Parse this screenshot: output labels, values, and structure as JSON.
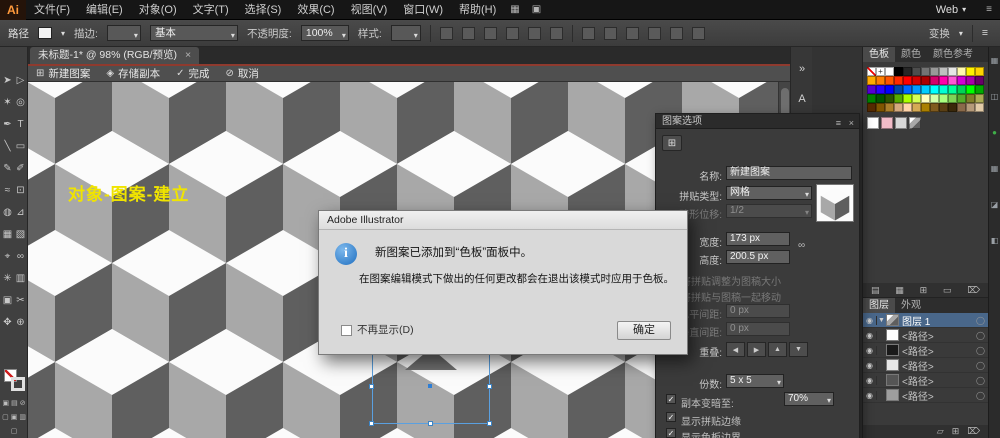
{
  "ui": {
    "caret": "▾",
    "close": "×",
    "menu": "≡",
    "check": "✓",
    "collapse": "»",
    "grid_icon": "⊞",
    "diamond_icon": "◈",
    "cancel_icon": "⊘",
    "info_glyph": "i",
    "link_icon": "∞",
    "tile_tool_icon": "⊞",
    "reg_glyph": "+"
  },
  "menu_bar": {
    "logo": "Ai",
    "items": [
      "文件(F)",
      "编辑(E)",
      "对象(O)",
      "文字(T)",
      "选择(S)",
      "效果(C)",
      "视图(V)",
      "窗口(W)",
      "帮助(H)"
    ],
    "window_icons": [
      "▦",
      "▣"
    ],
    "workspace": "Web"
  },
  "control_bar": {
    "object_label": "路径",
    "stroke_label": "描边:",
    "brush_value": "基本",
    "opacity_label": "不透明度:",
    "opacity_value": "100%",
    "style_label": "样式:",
    "transform_label": "变换"
  },
  "document_tab": {
    "title": "未标题-1* @ 98% (RGB/预览)"
  },
  "pattern_bar": {
    "name_label": "新建图案",
    "save_copy": "存储副本",
    "done": "完成",
    "cancel": "取消"
  },
  "canvas": {
    "annotation": "对象-图案-建立",
    "cube_colors": {
      "top": "#fbfbfb",
      "left": "#a8a8a8",
      "right": "#5f5f5f"
    }
  },
  "dialog": {
    "title": "Adobe Illustrator",
    "message_line1": "新图案已添加到“色板”面板中。",
    "message_line2": "在图案编辑模式下做出的任何更改都会在退出该模式时应用于色板。",
    "checkbox_label": "不再显示(D)",
    "ok_label": "确定"
  },
  "pattern_options": {
    "title": "图案选项",
    "name_label": "名称:",
    "name_value": "新建图案",
    "tile_type_label": "拼贴类型:",
    "tile_type_value": "网格",
    "brick_offset_label": "砖形位移:",
    "brick_offset_value": "1/2",
    "width_label": "宽度:",
    "width_value": "173 px",
    "height_label": "高度:",
    "height_value": "200.5 px",
    "size_tile_to_art": "将拼贴调整为图稿大小",
    "move_tile_with_art": "将拼贴与图稿一起移动",
    "h_spacing_label": "水平间距:",
    "h_spacing_value": "0 px",
    "v_spacing_label": "垂直间距:",
    "v_spacing_value": "0 px",
    "overlap_label": "重叠:",
    "copies_label": "份数:",
    "copies_value": "5 x 5",
    "dim_copies_label": "副本变暗至:",
    "dim_copies_value": "70%",
    "show_tile_edge": "显示拼贴边缘",
    "show_swatch_bounds": "显示色板边界"
  },
  "overlap_icons": [
    "◀",
    "▶",
    "▲",
    "▼"
  ],
  "tools": [
    {
      "name": "selection-tool",
      "glyph": "➤"
    },
    {
      "name": "direct-selection-tool",
      "glyph": "▷"
    },
    {
      "name": "magic-wand-tool",
      "glyph": "✶"
    },
    {
      "name": "lasso-tool",
      "glyph": "◎"
    },
    {
      "name": "pen-tool",
      "glyph": "✒"
    },
    {
      "name": "type-tool",
      "glyph": "T"
    },
    {
      "name": "line-segment-tool",
      "glyph": "╲"
    },
    {
      "name": "rectangle-tool",
      "glyph": "▭"
    },
    {
      "name": "paintbrush-tool",
      "glyph": "✎"
    },
    {
      "name": "pencil-tool",
      "glyph": "✐"
    },
    {
      "name": "width-tool",
      "glyph": "≈"
    },
    {
      "name": "free-transform-tool",
      "glyph": "⊡"
    },
    {
      "name": "shape-builder-tool",
      "glyph": "◍"
    },
    {
      "name": "perspective-grid-tool",
      "glyph": "⊿"
    },
    {
      "name": "mesh-tool",
      "glyph": "▦"
    },
    {
      "name": "gradient-tool",
      "glyph": "▧"
    },
    {
      "name": "eyedropper-tool",
      "glyph": "⌖"
    },
    {
      "name": "blend-tool",
      "glyph": "∞"
    },
    {
      "name": "symbol-sprayer-tool",
      "glyph": "✳"
    },
    {
      "name": "column-graph-tool",
      "glyph": "▥"
    },
    {
      "name": "artboard-tool",
      "glyph": "▣"
    },
    {
      "name": "slice-tool",
      "glyph": "✂"
    },
    {
      "name": "hand-tool",
      "glyph": "✥"
    },
    {
      "name": "zoom-tool",
      "glyph": "⊕"
    }
  ],
  "swatches_panel": {
    "tabs": [
      {
        "label": "色板",
        "bg": "#4a4a4a",
        "color": "#e8e8e8"
      },
      {
        "label": "颜色",
        "bg": "transparent",
        "color": "#b0b0b0"
      },
      {
        "label": "颜色参考",
        "bg": "transparent",
        "color": "#b0b0b0"
      }
    ],
    "colors": [
      "#ffffff",
      "#000000",
      "#262626",
      "#4d4d4d",
      "#737373",
      "#999999",
      "#bfbfbf",
      "#e6e6e6",
      "#fff9ae",
      "#fff200",
      "#ffd400",
      "#ffaa00",
      "#ff7f00",
      "#ff5500",
      "#ff2a00",
      "#ff0000",
      "#d40000",
      "#aa0000",
      "#d4006a",
      "#ff00aa",
      "#ff55d4",
      "#d400d4",
      "#aa00aa",
      "#6a006a",
      "#5500d4",
      "#2a00ff",
      "#0000ff",
      "#0044aa",
      "#0066ff",
      "#0099ff",
      "#00ccff",
      "#00ffff",
      "#00ffd4",
      "#00ff99",
      "#00d455",
      "#00ff00",
      "#00aa00",
      "#007f00",
      "#005500",
      "#2a5500",
      "#55aa00",
      "#aaff00",
      "#d4ff55",
      "#ffffbf",
      "#d4ffaa",
      "#aaff7f",
      "#7fd455",
      "#55aa2a",
      "#7f7f2a",
      "#aaaa55",
      "#552a00",
      "#7f5500",
      "#aa7f2a",
      "#d4aa7f",
      "#ffd4aa",
      "#d4aa55",
      "#aa7f00",
      "#7f5a1e",
      "#5a3f14",
      "#3a280a",
      "#8a6a4a",
      "#b59a7a",
      "#e2cba8"
    ],
    "extra": [
      "#ffffff",
      "#f2bcc8",
      "#d8d8d8",
      "linear-gradient(135deg,#ffffff 30%,#a8a8a8 30%,#a8a8a8 60%,#5f5f5f 60%)"
    ],
    "footer_icons": [
      "▤",
      "▦",
      "⊞",
      "▭",
      "⌦"
    ]
  },
  "layers_panel": {
    "tabs": [
      {
        "label": "图层",
        "bg": "#4a4a4a",
        "color": "#e8e8e8"
      },
      {
        "label": "外观",
        "bg": "transparent",
        "color": "#b0b0b0"
      }
    ],
    "rows": [
      {
        "label": "图层 1",
        "eye": "◉",
        "twist": "▼",
        "thumb": "linear-gradient(135deg,#ffffff 30%,#a8a8a8 30%,#a8a8a8 60%,#5f5f5f 60%)",
        "bg": "#49678a",
        "color": "#ffffff",
        "target": "◯"
      },
      {
        "label": "<路径>",
        "eye": "◉",
        "twist": "",
        "thumb": "#ffffff",
        "bg": "transparent",
        "color": "#c6c6c6",
        "target": "◯"
      },
      {
        "label": "<路径>",
        "eye": "◉",
        "twist": "",
        "thumb": "#1a1a1a",
        "bg": "transparent",
        "color": "#c6c6c6",
        "target": "◯"
      },
      {
        "label": "<路径>",
        "eye": "◉",
        "twist": "",
        "thumb": "#e6e6e6",
        "bg": "transparent",
        "color": "#c6c6c6",
        "target": "◯"
      },
      {
        "label": "<路径>",
        "eye": "◉",
        "twist": "",
        "thumb": "#555555",
        "bg": "transparent",
        "color": "#c6c6c6",
        "target": "◯"
      },
      {
        "label": "<路径>",
        "eye": "◉",
        "twist": "",
        "thumb": "#9e9e9e",
        "bg": "transparent",
        "color": "#c6c6c6",
        "target": "◯"
      }
    ],
    "footer_icons": [
      "▱",
      "⊞",
      "⌦"
    ]
  },
  "right_strip": {
    "icons": [
      {
        "g": "▦",
        "c": "#9aa0a6"
      },
      {
        "g": "◫",
        "c": "#9aa0a6"
      },
      {
        "g": "●",
        "c": "#3fae49"
      },
      {
        "g": "▦",
        "c": "#9aa0a6"
      },
      {
        "g": "◪",
        "c": "#9aa0a6"
      },
      {
        "g": "◧",
        "c": "#9aa0a6"
      }
    ]
  },
  "collapsed_dock": {
    "expand": "»",
    "char_icon": "A"
  },
  "toolbar_bottom": {
    "mini": [
      "▣",
      "▤",
      "⊘"
    ],
    "modes": [
      "▢",
      "▣",
      "▥"
    ],
    "screen": [
      "▢"
    ]
  }
}
